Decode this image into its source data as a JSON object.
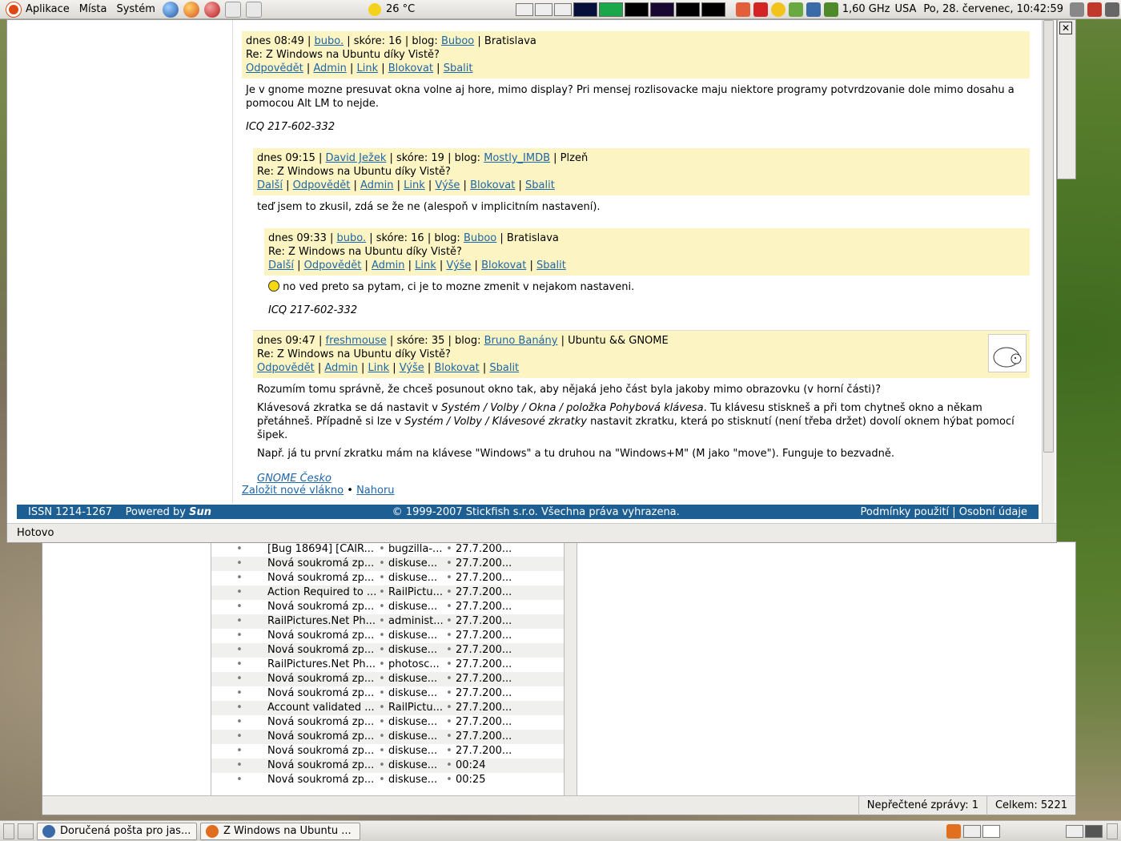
{
  "top_panel": {
    "menus": [
      "Aplikace",
      "Místa",
      "Systém"
    ],
    "weather": "26 °C",
    "cpu_freq": "1,60 GHz",
    "keyboard": "USA",
    "clock": "Po, 28. červenec, 10:42:59"
  },
  "comments": [
    {
      "time": "dnes 08:49",
      "author": "bubo.",
      "score": "skóre: 16",
      "blog_label": "blog:",
      "blog": "Buboo",
      "city": "Bratislava",
      "subject": "Re: Z Windows na Ubuntu díky Vistě?",
      "actions": [
        "Odpovědět",
        "Admin",
        "Link",
        "Blokovat",
        "Sbalit"
      ],
      "body": "Je v gnome mozne presuvat okna volne aj hore, mimo display? Pri mensej rozlisovacke maju niektore programy potvrdzovanie dole mimo dosahu a pomocou Alt LM to nejde.",
      "signature": "ICQ 217-602-332"
    },
    {
      "time": "dnes 09:15",
      "author": "David Ježek",
      "score": "skóre: 19",
      "blog_label": "blog:",
      "blog": "Mostly_IMDB",
      "city": "Plzeň",
      "subject": "Re: Z Windows na Ubuntu díky Vistě?",
      "actions": [
        "Další",
        "Odpovědět",
        "Admin",
        "Link",
        "Výše",
        "Blokovat",
        "Sbalit"
      ],
      "body": "teď jsem to zkusil, zdá se že ne (alespoň v implicitním nastavení)."
    },
    {
      "time": "dnes 09:33",
      "author": "bubo.",
      "score": "skóre: 16",
      "blog_label": "blog:",
      "blog": "Buboo",
      "city": "Bratislava",
      "subject": "Re: Z Windows na Ubuntu díky Vistě?",
      "actions": [
        "Další",
        "Odpovědět",
        "Admin",
        "Link",
        "Výše",
        "Blokovat",
        "Sbalit"
      ],
      "body": "no ved preto sa pytam, ci je to mozne zmenit v nejakom nastaveni.",
      "signature": "ICQ 217-602-332"
    },
    {
      "time": "dnes 09:47",
      "author": "freshmouse",
      "score": "skóre: 35",
      "blog_label": "blog:",
      "blog": "Bruno Banány",
      "city": "Ubuntu && GNOME",
      "subject": "Re: Z Windows na Ubuntu díky Vistě?",
      "actions": [
        "Odpovědět",
        "Admin",
        "Link",
        "Výše",
        "Blokovat",
        "Sbalit"
      ],
      "body1": "Rozumím tomu správně, že chceš posunout okno tak, aby nějaká jeho část byla jakoby mimo obrazovku (v horní části)?",
      "body2a": "Klávesová zkratka se dá nastavit v ",
      "body2b": "Systém / Volby / Okna / položka Pohybová klávesa",
      "body2c": ". Tu klávesu stiskneš a při tom chytneš okno a někam přetáhneš. Případně si lze v ",
      "body2d": "Systém / Volby / Klávesové zkratky",
      "body2e": " nastavit zkratku, která po stisknutí (není třeba držet) dovolí oknem hýbat pomocí šipek.",
      "body3": "Např. já tu první zkratku mám na klávese \"Windows\" a tu druhou na \"Windows+M\" (M jako \"move\"). Funguje to bezvadně.",
      "signature": "GNOME Česko"
    }
  ],
  "page_links": {
    "new_thread": "Založit nové vlákno",
    "separator": "•",
    "top": "Nahoru"
  },
  "footer": {
    "issn": "ISSN 1214-1267",
    "powered": "Powered by",
    "sun": "Sun",
    "copyright": "© 1999-2007 Stickfish s.r.o. Všechna práva vyhrazena.",
    "terms": "Podmínky použití",
    "privacy": "Osobní údaje"
  },
  "browser_status": "Hotovo",
  "mail": {
    "rows": [
      {
        "subject": "[Bug 18694] [CAIR...",
        "from": "bugzilla-...",
        "date": "27.7.200..."
      },
      {
        "subject": "Nová soukromá zp...",
        "from": "diskuse...",
        "date": "27.7.200..."
      },
      {
        "subject": "Nová soukromá zp...",
        "from": "diskuse...",
        "date": "27.7.200..."
      },
      {
        "subject": "Action Required to ...",
        "from": "RailPictu...",
        "date": "27.7.200..."
      },
      {
        "subject": "Nová soukromá zp...",
        "from": "diskuse...",
        "date": "27.7.200..."
      },
      {
        "subject": "RailPictures.Net Ph...",
        "from": "administ...",
        "date": "27.7.200..."
      },
      {
        "subject": "Nová soukromá zp...",
        "from": "diskuse...",
        "date": "27.7.200..."
      },
      {
        "subject": "Nová soukromá zp...",
        "from": "diskuse...",
        "date": "27.7.200..."
      },
      {
        "subject": "RailPictures.Net Ph...",
        "from": "photosc...",
        "date": "27.7.200..."
      },
      {
        "subject": "Nová soukromá zp...",
        "from": "diskuse...",
        "date": "27.7.200..."
      },
      {
        "subject": "Nová soukromá zp...",
        "from": "diskuse...",
        "date": "27.7.200..."
      },
      {
        "subject": "Account validated ...",
        "from": "RailPictu...",
        "date": "27.7.200..."
      },
      {
        "subject": "Nová soukromá zp...",
        "from": "diskuse...",
        "date": "27.7.200..."
      },
      {
        "subject": "Nová soukromá zp...",
        "from": "diskuse...",
        "date": "27.7.200..."
      },
      {
        "subject": "Nová soukromá zp...",
        "from": "diskuse...",
        "date": "27.7.200..."
      },
      {
        "subject": "Nová soukromá zp...",
        "from": "diskuse...",
        "date": "00:24"
      },
      {
        "subject": "Nová soukromá zp...",
        "from": "diskuse...",
        "date": "00:25"
      }
    ],
    "unread": "Nepřečtené zprávy: 1",
    "total": "Celkem: 5221"
  },
  "taskbar": {
    "task1": "Doručená pošta pro jas...",
    "task2": "Z Windows na Ubuntu ..."
  }
}
